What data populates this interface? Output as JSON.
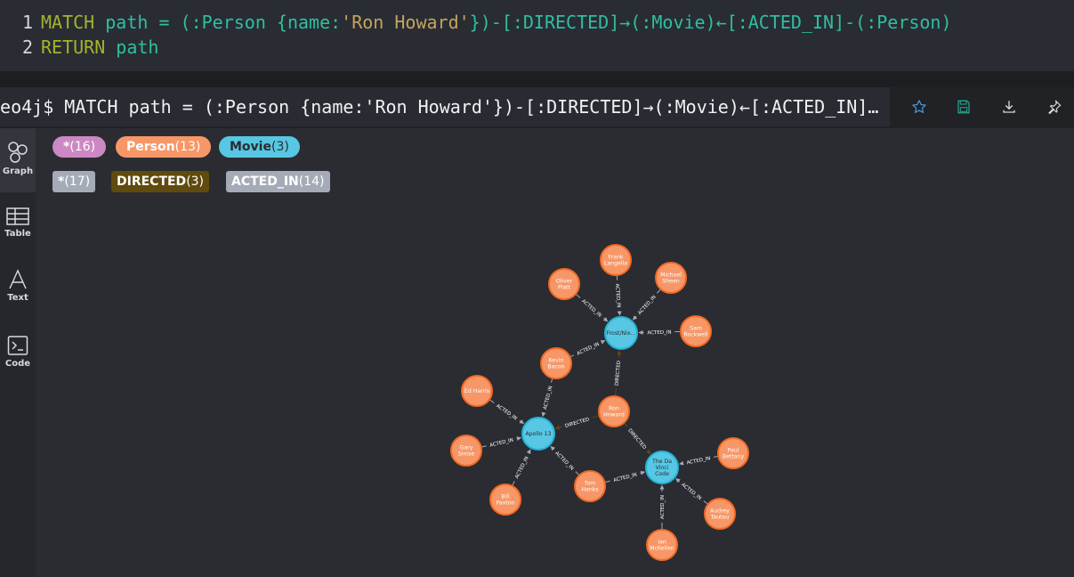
{
  "editor": {
    "line1": {
      "num": "1",
      "kw": "MATCH",
      "a": " path = (:Person {name:",
      "str": "'Ron Howard'",
      "b": "})-[:DIRECTED]→(:Movie)←[:ACTED_IN]-(:Person)"
    },
    "line2": {
      "num": "2",
      "kw": "RETURN",
      "rest": " path"
    }
  },
  "result": {
    "query": "neo4j$ MATCH path = (:Person {name:'Ron Howard'})-[:DIRECTED]→(:Movie)←[:ACTED_IN]…",
    "actions": [
      "star-icon",
      "save-icon",
      "download-icon",
      "pin-icon"
    ]
  },
  "sidebar": {
    "items": [
      {
        "label": "Graph",
        "icon": "graph-icon",
        "active": true
      },
      {
        "label": "Table",
        "icon": "table-icon",
        "active": false
      },
      {
        "label": "Text",
        "icon": "text-icon",
        "active": false
      },
      {
        "label": "Code",
        "icon": "code-icon",
        "active": false
      }
    ]
  },
  "legend": {
    "labels": [
      {
        "name": "*",
        "count": "(16)",
        "color": "#cc88c2",
        "text_color": "#ffffff"
      },
      {
        "name": "Person",
        "count": "(13)",
        "color": "#f79767",
        "text_color": "#ffffff"
      },
      {
        "name": "Movie",
        "count": "(3)",
        "color": "#57c7e3",
        "text_color": "#2a2c32"
      }
    ],
    "relationships": [
      {
        "name": "*",
        "count": "(17)",
        "color": "#a5abb6",
        "text_color": "#ffffff"
      },
      {
        "name": "DIRECTED",
        "count": "(3)",
        "color": "#604a0e",
        "text_color": "#ffffff"
      },
      {
        "name": "ACTED_IN",
        "count": "(14)",
        "color": "#a5abb6",
        "text_color": "#ffffff"
      }
    ]
  },
  "graph": {
    "colors": {
      "person": "#f79767",
      "person_stroke": "#f36924",
      "movie": "#57c7e3",
      "movie_stroke": "#23b3d7",
      "edge": "#a5abb6",
      "directed": "#604a0e"
    },
    "nodes": [
      {
        "id": "frost",
        "type": "movie",
        "lines": [
          "Frost/Nix..."
        ]
      },
      {
        "id": "apollo",
        "type": "movie",
        "lines": [
          "Apollo 13"
        ]
      },
      {
        "id": "davinci",
        "type": "movie",
        "lines": [
          "The Da",
          "Vinci",
          "Code"
        ]
      },
      {
        "id": "ron",
        "type": "person",
        "lines": [
          "Ron",
          "Howard"
        ]
      },
      {
        "id": "frank",
        "type": "person",
        "lines": [
          "Frank",
          "Langella"
        ]
      },
      {
        "id": "oliver",
        "type": "person",
        "lines": [
          "Oliver",
          "Platt"
        ]
      },
      {
        "id": "michael",
        "type": "person",
        "lines": [
          "Michael",
          "Sheen"
        ]
      },
      {
        "id": "sam",
        "type": "person",
        "lines": [
          "Sam",
          "Rockwell"
        ]
      },
      {
        "id": "kevin",
        "type": "person",
        "lines": [
          "Kevin",
          "Bacon"
        ]
      },
      {
        "id": "ed",
        "type": "person",
        "lines": [
          "Ed Harris"
        ]
      },
      {
        "id": "gary",
        "type": "person",
        "lines": [
          "Gary",
          "Sinise"
        ]
      },
      {
        "id": "bill",
        "type": "person",
        "lines": [
          "Bill",
          "Paxton"
        ]
      },
      {
        "id": "tom",
        "type": "person",
        "lines": [
          "Tom",
          "Hanks"
        ]
      },
      {
        "id": "paul",
        "type": "person",
        "lines": [
          "Paul",
          "Bettany"
        ]
      },
      {
        "id": "audrey",
        "type": "person",
        "lines": [
          "Audrey",
          "Tautou"
        ]
      },
      {
        "id": "ian",
        "type": "person",
        "lines": [
          "Ian",
          "McKellen"
        ]
      }
    ],
    "edges": [
      {
        "from": "ron",
        "to": "frost",
        "type": "DIRECTED"
      },
      {
        "from": "ron",
        "to": "apollo",
        "type": "DIRECTED"
      },
      {
        "from": "ron",
        "to": "davinci",
        "type": "DIRECTED"
      },
      {
        "from": "frank",
        "to": "frost",
        "type": "ACTED_IN"
      },
      {
        "from": "oliver",
        "to": "frost",
        "type": "ACTED_IN"
      },
      {
        "from": "michael",
        "to": "frost",
        "type": "ACTED_IN"
      },
      {
        "from": "sam",
        "to": "frost",
        "type": "ACTED_IN"
      },
      {
        "from": "kevin",
        "to": "frost",
        "type": "ACTED_IN"
      },
      {
        "from": "kevin",
        "to": "apollo",
        "type": "ACTED_IN"
      },
      {
        "from": "ed",
        "to": "apollo",
        "type": "ACTED_IN"
      },
      {
        "from": "gary",
        "to": "apollo",
        "type": "ACTED_IN"
      },
      {
        "from": "bill",
        "to": "apollo",
        "type": "ACTED_IN"
      },
      {
        "from": "tom",
        "to": "apollo",
        "type": "ACTED_IN"
      },
      {
        "from": "tom",
        "to": "davinci",
        "type": "ACTED_IN"
      },
      {
        "from": "paul",
        "to": "davinci",
        "type": "ACTED_IN"
      },
      {
        "from": "audrey",
        "to": "davinci",
        "type": "ACTED_IN"
      },
      {
        "from": "ian",
        "to": "davinci",
        "type": "ACTED_IN"
      }
    ]
  }
}
